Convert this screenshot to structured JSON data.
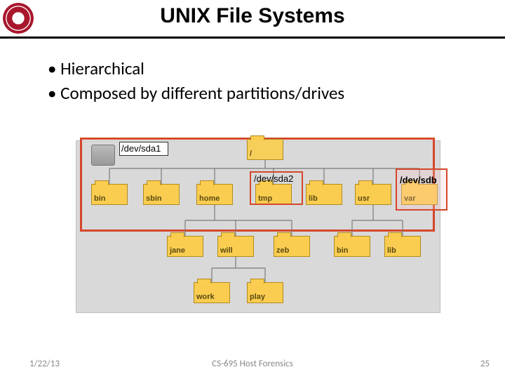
{
  "title": "UNIX File Systems",
  "bullets": {
    "b1": "Hierarchical",
    "b2": "Composed by different partitions/drives"
  },
  "devices": {
    "sda1": "/dev/sda1",
    "sda2": "/dev/sda2",
    "sdb": "/dev/sdb"
  },
  "folders": {
    "root": "/",
    "bin": "bin",
    "sbin": "sbin",
    "home": "home",
    "tmp": "tmp",
    "lib": "lib",
    "usr": "usr",
    "var": "var",
    "jane": "jane",
    "will": "will",
    "zeb": "zeb",
    "ubin": "bin",
    "ulib": "lib",
    "work": "work",
    "play": "play"
  },
  "footer": {
    "date": "1/22/13",
    "center": "CS-695 Host Forensics",
    "page": "25"
  }
}
